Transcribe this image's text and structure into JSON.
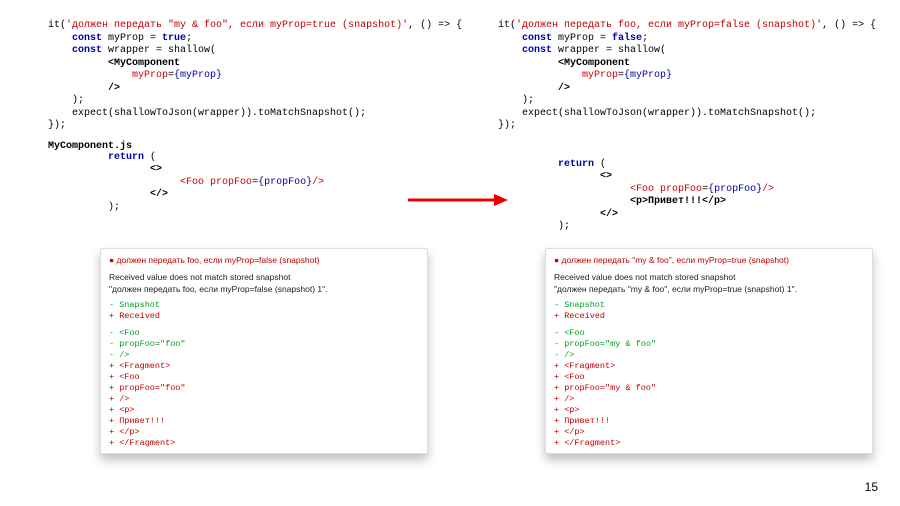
{
  "left": {
    "test": {
      "str": "'должен передать \"my & foo\", если myProp=true (snapshot)'",
      "const1_kw": "const",
      "const1_name": " myProp = ",
      "const1_val": "true",
      "const2_kw": "const",
      "const2_name": " wrapper = shallow(",
      "jsx_open": "<MyComponent",
      "jsx_attr_name": "myProp",
      "jsx_attr_eq": "=",
      "jsx_attr_val": "{myProp}",
      "jsx_close": "/>",
      "close_paren": ");",
      "expect": "expect(shallowToJson(wrapper)).toMatchSnapshot();",
      "end": "});"
    },
    "filename": "MyComponent.js",
    "snippet": {
      "ret": "return",
      "paren": " (",
      "frag_open": "<>",
      "foo_open": "<Foo ",
      "foo_attr_name": "propFoo",
      "foo_attr_eq": "=",
      "foo_attr_val": "{propFoo}",
      "foo_close": "/>",
      "frag_close": "</>",
      "end_paren": ");"
    },
    "card": {
      "title": "● должен передать foo, если myProp=false (snapshot)",
      "msg1": "Received value does not match stored snapshot",
      "msg2": "\"должен передать foo, если myProp=false (snapshot) 1\".",
      "snap_minus": "- Snapshot",
      "recv_plus": "+ Received",
      "diff": [
        {
          "c": "green",
          "t": "- <Foo"
        },
        {
          "c": "green",
          "t": "-   propFoo=\"foo\""
        },
        {
          "c": "green",
          "t": "- />"
        },
        {
          "c": "red",
          "t": "+ <Fragment>"
        },
        {
          "c": "red",
          "t": "+   <Foo"
        },
        {
          "c": "red",
          "t": "+     propFoo=\"foo\""
        },
        {
          "c": "red",
          "t": "+   />"
        },
        {
          "c": "red",
          "t": "+   <p>"
        },
        {
          "c": "red",
          "t": "+     Привет!!!"
        },
        {
          "c": "red",
          "t": "+   </p>"
        },
        {
          "c": "red",
          "t": "+ </Fragment>"
        }
      ]
    }
  },
  "right": {
    "test": {
      "str": "'должен передать foo, если myProp=false (snapshot)'",
      "const1_kw": "const",
      "const1_name": " myProp = ",
      "const1_val": "false",
      "const2_kw": "const",
      "const2_name": " wrapper = shallow(",
      "jsx_open": "<MyComponent",
      "jsx_attr_name": "myProp",
      "jsx_attr_eq": "=",
      "jsx_attr_val": "{myProp}",
      "jsx_close": "/>",
      "close_paren": ");",
      "expect": "expect(shallowToJson(wrapper)).toMatchSnapshot();",
      "end": "});"
    },
    "snippet": {
      "ret": "return",
      "paren": " (",
      "frag_open": "<>",
      "foo_open": "<Foo ",
      "foo_attr_name": "propFoo",
      "foo_attr_eq": "=",
      "foo_attr_val": "{propFoo}",
      "foo_close": "/>",
      "extra_line": "<p>Привет!!!</p>",
      "frag_close": "</>",
      "end_paren": ");"
    },
    "card": {
      "title": "● должен передать \"my & foo\", если myProp=true (snapshot)",
      "msg1": "Received value does not match stored snapshot",
      "msg2": "\"должен передать \"my & foo\", если myProp=true (snapshot) 1\".",
      "snap_minus": "- Snapshot",
      "recv_plus": "+ Received",
      "diff": [
        {
          "c": "green",
          "t": "- <Foo"
        },
        {
          "c": "green",
          "t": "-   propFoo=\"my & foo\""
        },
        {
          "c": "green",
          "t": "- />"
        },
        {
          "c": "red",
          "t": "+ <Fragment>"
        },
        {
          "c": "red",
          "t": "+   <Foo"
        },
        {
          "c": "red",
          "t": "+     propFoo=\"my & foo\""
        },
        {
          "c": "red",
          "t": "+   />"
        },
        {
          "c": "red",
          "t": "+   <p>"
        },
        {
          "c": "red",
          "t": "+     Привет!!!"
        },
        {
          "c": "red",
          "t": "+   </p>"
        },
        {
          "c": "red",
          "t": "+ </Fragment>"
        }
      ]
    }
  },
  "page_number": "15"
}
